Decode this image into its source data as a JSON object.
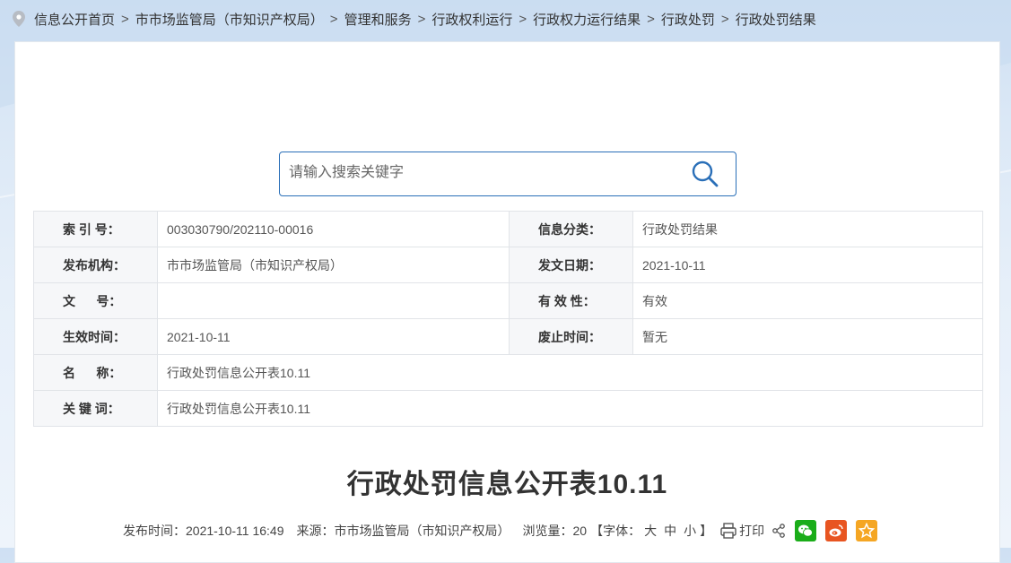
{
  "breadcrumb": [
    "信息公开首页",
    "市市场监管局（市知识产权局）",
    "管理和服务",
    "行政权利运行",
    "行政权力运行结果",
    "行政处罚",
    "行政处罚结果"
  ],
  "breadcrumb_separator": ">",
  "search": {
    "placeholder": "请输入搜索关键字",
    "value": ""
  },
  "meta": {
    "index_label": "索 引 号：",
    "index_value": "003030790/202110-00016",
    "category_label": "信息分类：",
    "category_value": "行政处罚结果",
    "publisher_label": "发布机构：",
    "publisher_value": "市市场监管局（市知识产权局）",
    "issue_date_label": "发文日期：",
    "issue_date_value": "2021-10-11",
    "doc_no_label": "文      号：",
    "doc_no_value": "",
    "validity_label": "有 效 性：",
    "validity_value": "有效",
    "effective_label": "生效时间：",
    "effective_value": "2021-10-11",
    "expire_label": "废止时间：",
    "expire_value": "暂无",
    "name_label": "名      称：",
    "name_value": "行政处罚信息公开表10.11",
    "keywords_label": "关 键 词：",
    "keywords_value": "行政处罚信息公开表10.11"
  },
  "article": {
    "title": "行政处罚信息公开表10.11",
    "publish_time_label": "发布时间：",
    "publish_time": "2021-10-11 16:49",
    "source_label": "来源：",
    "source": "市市场监管局（市知识产权局）",
    "views_label": "浏览量：",
    "views": "20",
    "font_size_open": "【字体：",
    "font_large": "大",
    "font_medium": "中",
    "font_small": "小",
    "font_size_close": "】",
    "print_label": "打印"
  },
  "colors": {
    "accent": "#2a6fb8",
    "wechat": "#1aad19",
    "weibo": "#e85521",
    "favorite": "#f5a623"
  },
  "icons": [
    "location-pin-icon",
    "search-icon",
    "print-icon",
    "share-icon",
    "wechat-icon",
    "weibo-icon",
    "star-icon"
  ]
}
